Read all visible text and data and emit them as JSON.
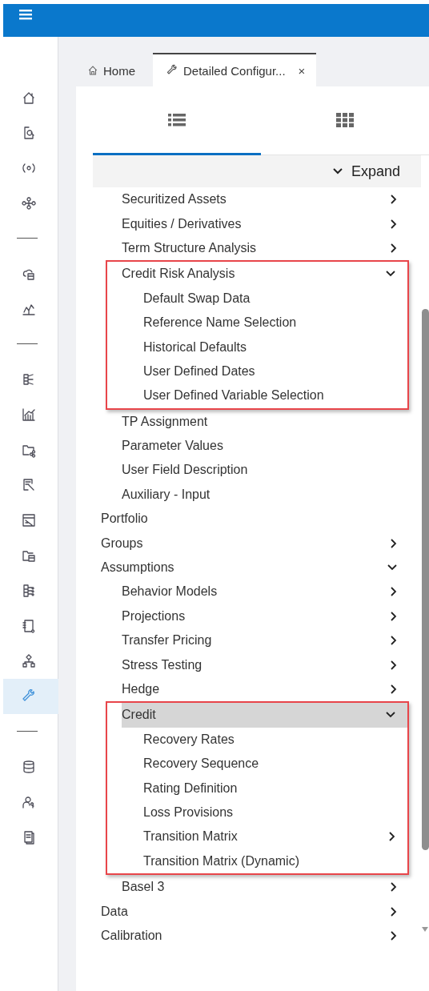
{
  "sidebar": {
    "items": [
      {
        "kind": "icon",
        "selected": false
      },
      {
        "kind": "icon",
        "selected": false
      },
      {
        "kind": "icon",
        "selected": false
      },
      {
        "kind": "icon",
        "selected": false
      },
      {
        "kind": "divider"
      },
      {
        "kind": "icon",
        "selected": false
      },
      {
        "kind": "icon",
        "selected": false
      },
      {
        "kind": "divider"
      },
      {
        "kind": "icon",
        "selected": false
      },
      {
        "kind": "icon",
        "selected": false
      },
      {
        "kind": "icon",
        "selected": false
      },
      {
        "kind": "icon",
        "selected": false
      },
      {
        "kind": "icon",
        "selected": false
      },
      {
        "kind": "icon",
        "selected": false
      },
      {
        "kind": "icon",
        "selected": false
      },
      {
        "kind": "icon",
        "selected": false
      },
      {
        "kind": "icon",
        "selected": false
      },
      {
        "kind": "icon",
        "selected": true
      },
      {
        "kind": "divider"
      },
      {
        "kind": "icon",
        "selected": false
      },
      {
        "kind": "icon",
        "selected": false
      },
      {
        "kind": "icon",
        "selected": false
      }
    ]
  },
  "tabs": [
    {
      "label": "Home",
      "selected": false,
      "closable": false
    },
    {
      "label": "Detailed Configur...",
      "selected": true,
      "closable": true,
      "close": "×"
    }
  ],
  "view_tabs": [
    {
      "selected": true
    },
    {
      "selected": false
    }
  ],
  "expand_button": {
    "label": "Expand"
  },
  "tree": {
    "scrolled_parent_children": [
      {
        "label": "Securitized Assets",
        "expanded": false,
        "selected": false
      },
      {
        "label": "Equities / Derivatives",
        "expanded": false,
        "selected": false
      },
      {
        "label": "Term Structure Analysis",
        "expanded": false,
        "selected": false
      },
      {
        "label": "Credit Risk Analysis",
        "expanded": true,
        "selected": false,
        "annotated": true,
        "children": [
          {
            "label": "Default Swap Data",
            "selected": false
          },
          {
            "label": "Reference Name Selection",
            "selected": false
          },
          {
            "label": "Historical Defaults",
            "selected": false
          },
          {
            "label": "User Defined Dates",
            "selected": false
          },
          {
            "label": "User Defined Variable Selection",
            "selected": false
          }
        ]
      },
      {
        "label": "TP Assignment",
        "selected": false
      },
      {
        "label": "Parameter Values",
        "selected": false
      },
      {
        "label": "User Field Description",
        "selected": false
      },
      {
        "label": "Auxiliary - Input",
        "selected": false
      }
    ],
    "items": [
      {
        "label": "Portfolio",
        "selected": false
      },
      {
        "label": "Groups",
        "expanded": false,
        "selected": false
      },
      {
        "label": "Assumptions",
        "expanded": true,
        "selected": false,
        "children": [
          {
            "label": "Behavior Models",
            "expanded": false,
            "selected": false
          },
          {
            "label": "Projections",
            "expanded": false,
            "selected": false
          },
          {
            "label": "Transfer Pricing",
            "expanded": false,
            "selected": false
          },
          {
            "label": "Stress Testing",
            "expanded": false,
            "selected": false
          },
          {
            "label": "Hedge",
            "expanded": false,
            "selected": false
          },
          {
            "label": "Credit",
            "expanded": true,
            "selected": true,
            "annotated": true,
            "children": [
              {
                "label": "Recovery Rates",
                "selected": false
              },
              {
                "label": "Recovery Sequence",
                "selected": false
              },
              {
                "label": "Rating Definition",
                "selected": false
              },
              {
                "label": "Loss Provisions",
                "selected": false
              },
              {
                "label": "Transition Matrix",
                "expanded": false,
                "selected": false
              },
              {
                "label": "Transition Matrix (Dynamic)",
                "selected": false
              }
            ]
          },
          {
            "label": "Basel 3",
            "expanded": false,
            "selected": false
          }
        ]
      },
      {
        "label": "Data",
        "expanded": false,
        "selected": false
      },
      {
        "label": "Calibration",
        "expanded": false,
        "selected": false
      }
    ]
  }
}
